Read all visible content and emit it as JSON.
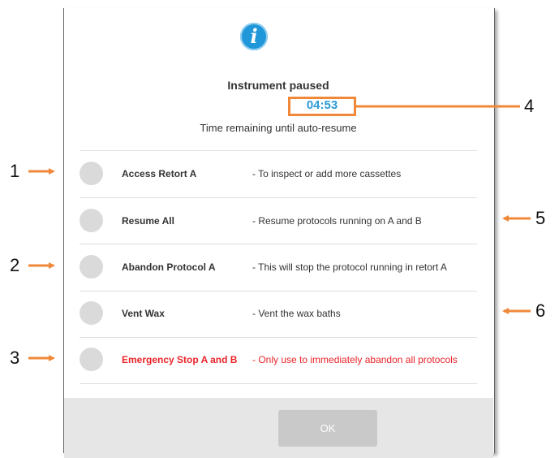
{
  "dialog": {
    "title": "Instrument paused",
    "timer": "04:53",
    "timer_caption": "Time remaining until auto-resume",
    "info_icon": "info-icon",
    "options": [
      {
        "label": "Access Retort A",
        "desc": "-  To inspect or add more cassettes",
        "danger": false
      },
      {
        "label": "Resume All",
        "desc": "-  Resume protocols running on A and B",
        "danger": false
      },
      {
        "label": "Abandon Protocol A",
        "desc": "-  This will stop the protocol running in retort A",
        "danger": false
      },
      {
        "label": "Vent Wax",
        "desc": "-  Vent the wax baths",
        "danger": false
      },
      {
        "label": "Emergency Stop A and B",
        "desc": "-  Only use to immediately abandon all protocols",
        "danger": true
      }
    ],
    "ok_label": "OK"
  },
  "callouts": [
    "1",
    "2",
    "3",
    "4",
    "5",
    "6"
  ],
  "colors": {
    "accent_orange": "#f0883a",
    "timer_blue": "#2d9ad6",
    "danger_red": "#e8242a",
    "icon_blue": "#1f97d8"
  }
}
